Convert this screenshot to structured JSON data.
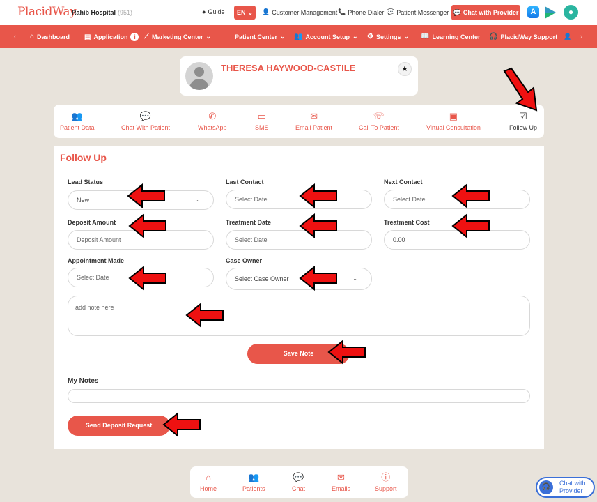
{
  "topbar": {
    "logo": "PlacidWay",
    "hospital_name": "Rahib Hospital",
    "hospital_code": "(951)",
    "guide": "Guide",
    "language": "EN",
    "customer_management": "Customer Management",
    "phone_dialer": "Phone Dialer",
    "patient_messenger": "Patient Messenger",
    "chat_with_provider": "Chat with Provider"
  },
  "nav": {
    "items": [
      "Dashboard",
      "Application",
      "Marketing Center",
      "Patient Center",
      "Account Setup",
      "Settings",
      "Learning Center",
      "PlacidWay Support"
    ],
    "application_badge": "i"
  },
  "patient": {
    "name": "THERESA HAYWOOD-CASTILE"
  },
  "tabs": [
    "Patient Data",
    "Chat With Patient",
    "WhatsApp",
    "SMS",
    "Email Patient",
    "Call To Patient",
    "Virtual Consultation",
    "Follow Up"
  ],
  "form": {
    "title": "Follow Up",
    "lead_status": {
      "label": "Lead Status",
      "value": "New"
    },
    "last_contact": {
      "label": "Last Contact",
      "placeholder": "Select Date"
    },
    "next_contact": {
      "label": "Next Contact",
      "placeholder": "Select Date"
    },
    "deposit_amount": {
      "label": "Deposit Amount",
      "placeholder": "Deposit Amount"
    },
    "treatment_date": {
      "label": "Treatment Date",
      "placeholder": "Select Date"
    },
    "treatment_cost": {
      "label": "Treatment Cost",
      "value": "0.00"
    },
    "appointment_made": {
      "label": "Appointment Made",
      "placeholder": "Select Date"
    },
    "case_owner": {
      "label": "Case Owner",
      "value": "Select Case Owner"
    },
    "note_placeholder": "add note here",
    "save_note": "Save Note",
    "my_notes": "My Notes",
    "send_deposit": "Send Deposit Request"
  },
  "bottom_nav": [
    "Home",
    "Patients",
    "Chat",
    "Emails",
    "Support"
  ],
  "chat_widget": {
    "line1": "Chat with",
    "line2": "Provider"
  },
  "colors": {
    "accent": "#e8564a",
    "background": "#e8e3db",
    "arrow": "#ee1111",
    "widget": "#3a6fd8"
  }
}
